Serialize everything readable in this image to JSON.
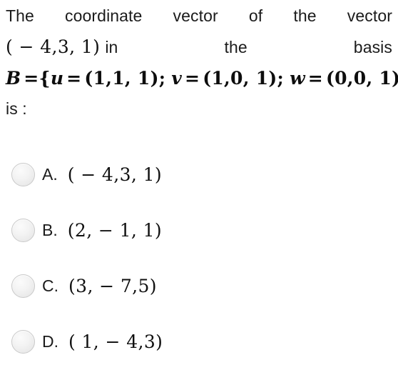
{
  "question": {
    "line1_words": [
      "The",
      "coordinate",
      "vector",
      "of",
      "the",
      "vector"
    ],
    "line2_vector": "( − 4,3, 1)",
    "line2_in": "in",
    "line2_the": "the",
    "line2_basis": "basis",
    "basis": {
      "name": "B",
      "eq1": "=",
      "open_brace": "{",
      "u_name": "u",
      "u_eq": "=",
      "u_value": "(1,1, 1)",
      "sep1": ";",
      "v_name": "v",
      "v_eq": "=",
      "v_value": "(1,0, 1)",
      "sep2": ";",
      "w_name": "w",
      "w_eq": "=",
      "w_value": "(0,0, 1)",
      "close_brace": "}"
    },
    "is_label": "is :"
  },
  "options": [
    {
      "letter": "A.",
      "value": "( − 4,3, 1)",
      "selected": false
    },
    {
      "letter": "B.",
      "value": "(2, − 1, 1)",
      "selected": false
    },
    {
      "letter": "C.",
      "value": "(3, − 7,5)",
      "selected": false
    },
    {
      "letter": "D.",
      "value": "( 1, − 4,3)",
      "selected": false
    }
  ],
  "colors": {
    "background": "#ffffff",
    "text": "#1b1b1b",
    "math_text": "#101010",
    "radio_border": "#c9c9c9",
    "radio_fill": "#f0f0f0"
  }
}
